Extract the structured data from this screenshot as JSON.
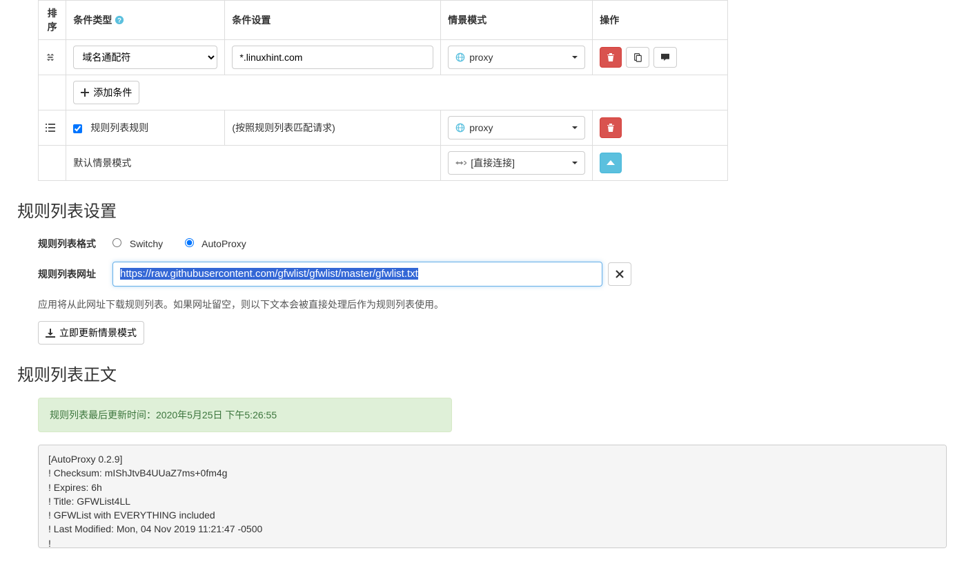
{
  "table": {
    "headers": {
      "sort": "排序",
      "type": "条件类型",
      "setting": "条件设置",
      "profile": "情景模式",
      "action": "操作"
    },
    "row1": {
      "type_select": "域名通配符",
      "setting_value": "*.linuxhint.com",
      "profile_label": "proxy"
    },
    "add_condition": "添加条件",
    "row_rule_list": {
      "label": "规则列表规则",
      "setting": "(按照规则列表匹配请求)",
      "profile_label": "proxy"
    },
    "row_default": {
      "label": "默认情景模式",
      "profile_label": "[直接连接]"
    }
  },
  "section_rules_settings": {
    "title": "规则列表设置",
    "format_label": "规则列表格式",
    "format_switchy": "Switchy",
    "format_autoproxy": "AutoProxy",
    "url_label": "规则列表网址",
    "url_value": "https://raw.githubusercontent.com/gfwlist/gfwlist/master/gfwlist.txt",
    "url_description": "应用将从此网址下载规则列表。如果网址留空，则以下文本会被直接处理后作为规则列表使用。",
    "update_button": "立即更新情景模式"
  },
  "section_rules_text": {
    "title": "规则列表正文",
    "last_update_prefix": "规则列表最后更新时间：",
    "last_update_time": "2020年5月25日 下午5:26:55",
    "content": "[AutoProxy 0.2.9]\n! Checksum: mIShJtvB4UUaZ7ms+0fm4g\n! Expires: 6h\n! Title: GFWList4LL\n! GFWList with EVERYTHING included\n! Last Modified: Mon, 04 Nov 2019 11:21:47 -0500\n!"
  }
}
